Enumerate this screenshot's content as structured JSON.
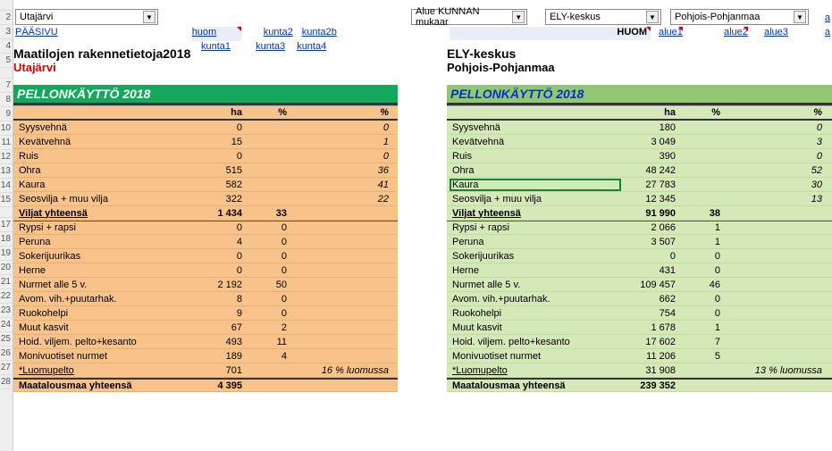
{
  "row_numbers": [
    "",
    "2",
    "3",
    "4",
    "5",
    "",
    "7",
    "8",
    "9",
    "10",
    "11",
    "12",
    "13",
    "14",
    "15",
    "",
    "17",
    "18",
    "19",
    "20",
    "21",
    "22",
    "23",
    "24",
    "25",
    "26",
    "27",
    "28"
  ],
  "dropdowns": {
    "kunta": "Utajärvi",
    "alue_kunnan": "Alue KUNNAN mukaar",
    "ely": "ELY-keskus",
    "pohjois": "Pohjois-Pohjanmaa"
  },
  "links": {
    "paasivu": "PÄÄSIVU",
    "huom": "huom",
    "kunta1": "kunta1",
    "kunta2": "kunta2",
    "kunta2b": "kunta2b",
    "kunta3": "kunta3",
    "kunta4": "kunta4",
    "huom_right": "HUOM",
    "alue1": "alue1",
    "alue2": "alue2",
    "alue3": "alue3",
    "a": "a"
  },
  "left": {
    "title": "Maatilojen rakennetietoja2018",
    "subtitle": "Utajärvi",
    "header": "PELLONKÄYTTÖ 2018",
    "cols": {
      "ha": "ha",
      "pct": "%",
      "pct2": "%"
    },
    "rows": [
      {
        "label": "Syysvehnä",
        "ha": "0",
        "pct": "",
        "pct2": "0"
      },
      {
        "label": "Kevätvehnä",
        "ha": "15",
        "pct": "",
        "pct2": "1"
      },
      {
        "label": "Ruis",
        "ha": "0",
        "pct": "",
        "pct2": "0"
      },
      {
        "label": "Ohra",
        "ha": "515",
        "pct": "",
        "pct2": "36"
      },
      {
        "label": "Kaura",
        "ha": "582",
        "pct": "",
        "pct2": "41"
      },
      {
        "label": "Seosvilja + muu vilja",
        "ha": "322",
        "pct": "",
        "pct2": "22"
      },
      {
        "label": " Viljat yhteensä",
        "ha": "1 434",
        "pct": "33",
        "pct2": "",
        "bold": true,
        "under": true
      },
      {
        "label": "Rypsi + rapsi",
        "ha": "0",
        "pct": "0",
        "pct2": "",
        "top": true
      },
      {
        "label": "Peruna",
        "ha": "4",
        "pct": "0",
        "pct2": ""
      },
      {
        "label": "Sokerijuurikas",
        "ha": "0",
        "pct": "0",
        "pct2": ""
      },
      {
        "label": "Herne",
        "ha": "0",
        "pct": "0",
        "pct2": ""
      },
      {
        "label": "Nurmet alle 5 v.",
        "ha": "2 192",
        "pct": "50",
        "pct2": ""
      },
      {
        "label": "Avom. vih.+puutarhak.",
        "ha": "8",
        "pct": "0",
        "pct2": ""
      },
      {
        "label": "Ruokohelpi",
        "ha": "9",
        "pct": "0",
        "pct2": ""
      },
      {
        "label": "Muut kasvit",
        "ha": "67",
        "pct": "2",
        "pct2": ""
      },
      {
        "label": "Hoid. viljem. pelto+kesanto",
        "ha": "493",
        "pct": "11",
        "pct2": ""
      },
      {
        "label": "Monivuotiset nurmet",
        "ha": "189",
        "pct": "4",
        "pct2": ""
      },
      {
        "label": "*Luomupelto",
        "ha": "701",
        "pct": "",
        "pct2": "16 % luomussa",
        "under": true
      },
      {
        "label": "Maatalousmaa yhteensä",
        "ha": "4 395",
        "pct": "",
        "pct2": "",
        "bold": true,
        "totalline": true
      }
    ]
  },
  "right": {
    "title": "ELY-keskus",
    "subtitle": "Pohjois-Pohjanmaa",
    "header": "PELLONKÄYTTÖ 2018",
    "cols": {
      "ha": "ha",
      "pct": "%",
      "pct2": "%"
    },
    "rows": [
      {
        "label": "Syysvehnä",
        "ha": "180",
        "pct": "",
        "pct2": "0"
      },
      {
        "label": "Kevätvehnä",
        "ha": "3 049",
        "pct": "",
        "pct2": "3"
      },
      {
        "label": "Ruis",
        "ha": "390",
        "pct": "",
        "pct2": "0"
      },
      {
        "label": "Ohra",
        "ha": "48 242",
        "pct": "",
        "pct2": "52"
      },
      {
        "label": "Kaura",
        "ha": "27 783",
        "pct": "",
        "pct2": "30",
        "sel": true
      },
      {
        "label": "Seosvilja + muu vilja",
        "ha": "12 345",
        "pct": "",
        "pct2": "13"
      },
      {
        "label": " Viljat yhteensä",
        "ha": "91 990",
        "pct": "38",
        "pct2": "",
        "bold": true,
        "under": true
      },
      {
        "label": "Rypsi + rapsi",
        "ha": "2 066",
        "pct": "1",
        "pct2": "",
        "top": true
      },
      {
        "label": "Peruna",
        "ha": "3 507",
        "pct": "1",
        "pct2": ""
      },
      {
        "label": "Sokerijuurikas",
        "ha": "0",
        "pct": "0",
        "pct2": ""
      },
      {
        "label": "Herne",
        "ha": "431",
        "pct": "0",
        "pct2": ""
      },
      {
        "label": "Nurmet alle 5 v.",
        "ha": "109 457",
        "pct": "46",
        "pct2": ""
      },
      {
        "label": "Avom. vih.+puutarhak.",
        "ha": "662",
        "pct": "0",
        "pct2": ""
      },
      {
        "label": "Ruokohelpi",
        "ha": "754",
        "pct": "0",
        "pct2": ""
      },
      {
        "label": "Muut kasvit",
        "ha": "1 678",
        "pct": "1",
        "pct2": ""
      },
      {
        "label": "Hoid. viljem. pelto+kesanto",
        "ha": "17 602",
        "pct": "7",
        "pct2": ""
      },
      {
        "label": "Monivuotiset nurmet",
        "ha": "11 206",
        "pct": "5",
        "pct2": ""
      },
      {
        "label": "*Luomupelto",
        "ha": "31 908",
        "pct": "",
        "pct2": "13 % luomussa",
        "under": true
      },
      {
        "label": "Maatalousmaa yhteensä",
        "ha": "239 352",
        "pct": "",
        "pct2": "",
        "bold": true,
        "totalline": true
      }
    ]
  }
}
